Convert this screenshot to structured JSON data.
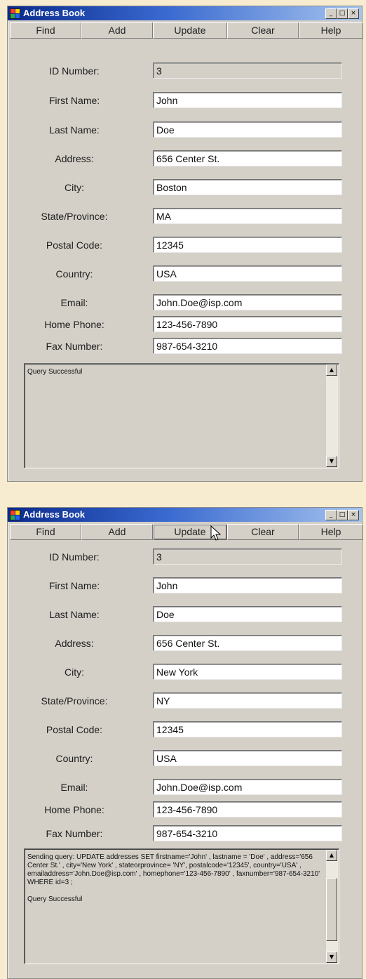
{
  "window_title": "Address Book",
  "toolbar": {
    "find": "Find",
    "add": "Add",
    "update": "Update",
    "clear": "Clear",
    "help": "Help"
  },
  "labels": {
    "id": "ID Number:",
    "first": "First Name:",
    "last": "Last Name:",
    "address": "Address:",
    "city": "City:",
    "state": "State/Province:",
    "postal": "Postal Code:",
    "country": "Country:",
    "email": "Email:",
    "home_phone": "Home Phone:",
    "fax": "Fax Number:"
  },
  "record_before": {
    "id": "3",
    "first": "John",
    "last": "Doe",
    "address": "656 Center St.",
    "city": "Boston",
    "state": "MA",
    "postal": "12345",
    "country": "USA",
    "email": "John.Doe@isp.com",
    "home_phone": "123-456-7890",
    "fax": "987-654-3210",
    "output": "Query Successful"
  },
  "record_after": {
    "id": "3",
    "first": "John",
    "last": "Doe",
    "address": "656 Center St.",
    "city": "New York",
    "state": "NY",
    "postal": "12345",
    "country": "USA",
    "email": "John.Doe@isp.com",
    "home_phone": "123-456-7890",
    "fax": "987-654-3210",
    "output": "Sending query: UPDATE addresses SET firstname='John' , lastname = 'Doe' , address='656 Center St.' , city='New York' , stateorprovince= 'NY', postalcode='12345', country='USA' , emailaddress='John.Doe@isp.com' , homephone='123-456-7890' , faxnumber='987-654-3210' WHERE id=3 ;\n\nQuery Successful"
  },
  "icons": {
    "min": "minimize-icon",
    "max": "maximize-icon",
    "close": "close-icon",
    "up": "scroll-up-icon",
    "down": "scroll-down-icon"
  }
}
